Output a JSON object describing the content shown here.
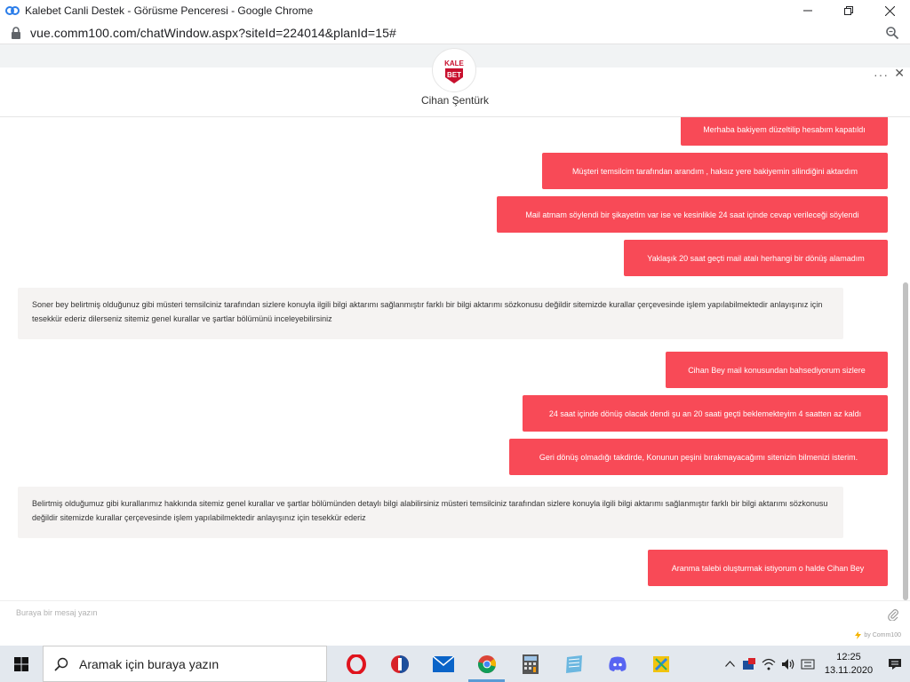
{
  "browser": {
    "window_title": "Kalebet Canli Destek - Görüsme Penceresi - Google Chrome",
    "url": "vue.comm100.com/chatWindow.aspx?siteId=224014&planId=15#"
  },
  "chat": {
    "logo_line1": "KALE",
    "logo_line2": "BET",
    "agent_name": "Cihan Şentürk",
    "more_label": "···",
    "close_label": "✕",
    "messages": [
      {
        "from": "visitor",
        "text": "Merhaba bakiyem düzeltilip hesabım kapatıldı"
      },
      {
        "from": "visitor",
        "text": "Müşteri temsilcim tarafından arandım , haksız yere bakiyemin silindiğini aktardım"
      },
      {
        "from": "visitor",
        "text": "Mail atmam söylendi bir şikayetim var ise ve kesinlikle 24 saat içinde cevap verileceği söylendi"
      },
      {
        "from": "visitor",
        "text": "Yaklaşık 20 saat geçti mail atalı herhangi bir dönüş alamadım"
      },
      {
        "from": "agent",
        "text": "Soner bey belirtmiş olduğunuz gibi müsteri temsilciniz tarafından sizlere konuyla ilgili bilgi aktarımı sağlanmıştır farklı bir bilgi aktarımı sözkonusu değildir sitemizde kurallar çerçevesinde işlem yapılabilmektedir anlayışınız için tesekkür ederiz dilerseniz sitemiz genel kurallar ve şartlar bölümünü inceleyebilirsiniz"
      },
      {
        "from": "visitor",
        "text": "Cihan Bey mail konusundan bahsediyorum sizlere"
      },
      {
        "from": "visitor",
        "text": "24 saat içinde dönüş olacak dendi şu an 20 saati geçti beklemekteyim 4 saatten az kaldı"
      },
      {
        "from": "visitor",
        "text": "Geri dönüş olmadığı takdirde, Konunun peşini bırakmayacağımı sitenizin bilmenizi isterim."
      },
      {
        "from": "agent",
        "text": "Belirtmiş olduğumuz gibi kurallarımız hakkında sitemiz genel kurallar ve şartlar bölümünden detaylı bilgi alabilirsiniz müsteri temsilciniz tarafından sizlere konuyla ilgili bilgi aktarımı sağlanmıştır farklı bir bilgi aktarımı sözkonusu değildir sitemizde kurallar çerçevesinde işlem yapılabilmektedir anlayışınız için tesekkür ederiz"
      },
      {
        "from": "visitor",
        "text": "Aranma talebi oluşturmak istiyorum o halde Cihan Bey"
      }
    ],
    "input_placeholder": "Buraya bir mesaj yazın",
    "powered_by": "by Comm100"
  },
  "taskbar": {
    "search_placeholder": "Aramak için buraya yazın",
    "time": "12:25",
    "date": "13.11.2020"
  },
  "colors": {
    "visitor_bubble": "#f84a57",
    "agent_bubble": "#f5f3f2"
  }
}
